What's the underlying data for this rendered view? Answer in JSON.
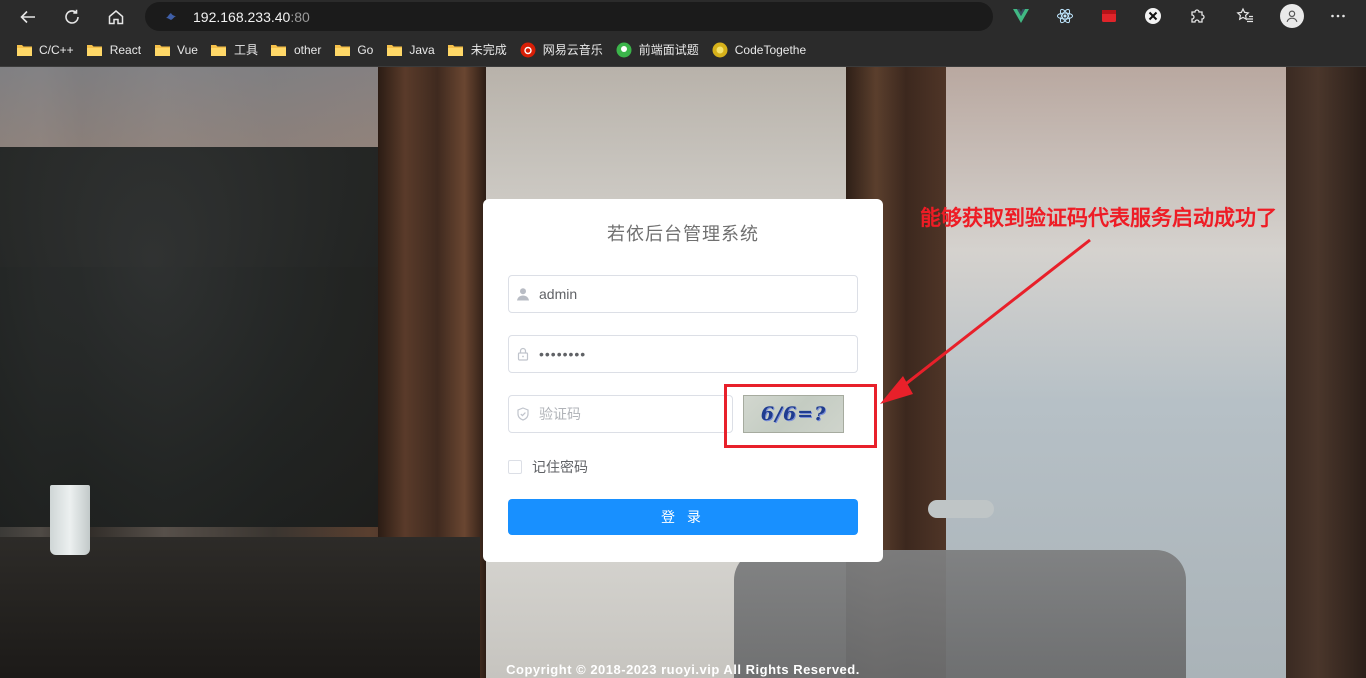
{
  "browser": {
    "address": "192.168.233.40",
    "port": ":80",
    "bookmarks": [
      {
        "label": "C/C++",
        "icon": "folder-icon"
      },
      {
        "label": "React",
        "icon": "folder-icon"
      },
      {
        "label": "Vue",
        "icon": "folder-icon"
      },
      {
        "label": "工具",
        "icon": "folder-icon"
      },
      {
        "label": "other",
        "icon": "folder-icon"
      },
      {
        "label": "Go",
        "icon": "folder-icon"
      },
      {
        "label": "Java",
        "icon": "folder-icon"
      },
      {
        "label": "未完成",
        "icon": "folder-icon"
      },
      {
        "label": "网易云音乐",
        "icon": "netease-music-icon"
      },
      {
        "label": "前端面试题",
        "icon": "interview-site-icon"
      },
      {
        "label": "CodeTogethe",
        "icon": "codetogether-icon"
      }
    ],
    "colors": {
      "chrome": "#2b2b2b",
      "address_bar": "#1b1b1b"
    }
  },
  "login": {
    "title": "若依后台管理系统",
    "username_value": "admin",
    "password_value": "••••••••",
    "captcha_placeholder": "验证码",
    "captcha_text": "6/6=?",
    "remember_label": "记住密码",
    "login_button": "登 录",
    "colors": {
      "primary": "#1890ff"
    }
  },
  "annotation": {
    "text": "能够获取到验证码代表服务启动成功了",
    "color": "#e8202a"
  },
  "footer": {
    "copyright": "Copyright © 2018-2023 ruoyi.vip All Rights Reserved."
  }
}
